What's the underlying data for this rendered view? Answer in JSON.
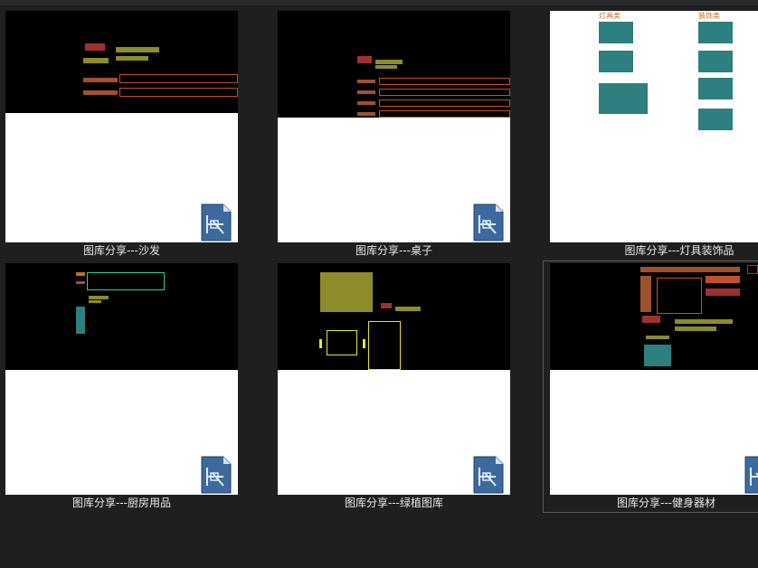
{
  "gallery": {
    "items": [
      {
        "caption": "图库分享---沙发"
      },
      {
        "caption": "图库分享---桌子"
      },
      {
        "caption": "图库分享---灯具装饰品",
        "labels": [
          "灯具类",
          "装饰类"
        ]
      },
      {
        "caption": "图库分享---厨房用品"
      },
      {
        "caption": "图库分享---绿植图库"
      },
      {
        "caption": "图库分享---健身器材"
      }
    ]
  },
  "colors": {
    "background": "#1f1f1f",
    "caption_text": "#e8e8e8",
    "selected_outline": "#5a5a5a",
    "cad_olive": "#8c8c2a",
    "cad_brown": "#a0522d",
    "cad_teal": "#2e7f7f",
    "cad_yellow": "#e6e62e"
  },
  "icons": [
    "dwg-file-icon"
  ]
}
